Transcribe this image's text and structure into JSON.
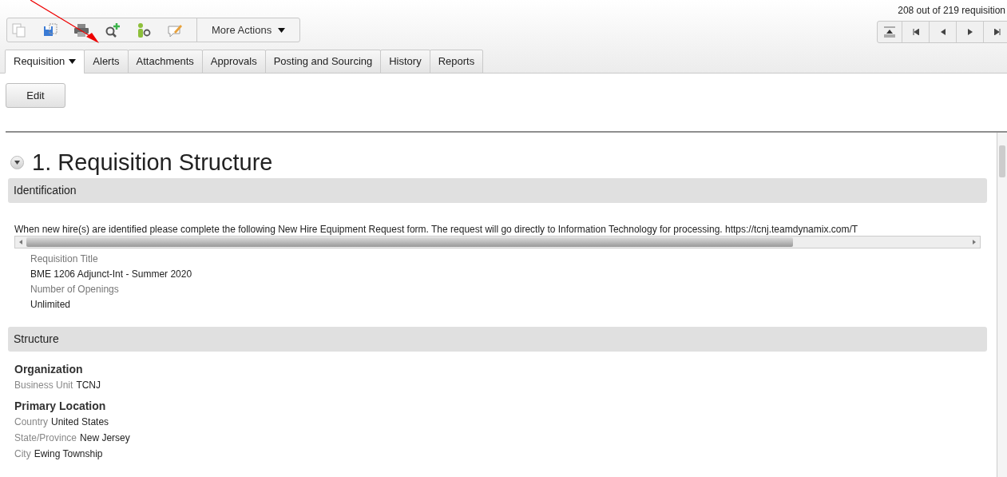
{
  "toolbar": {
    "more_actions": "More Actions"
  },
  "counter": "208 out of 219 requisition",
  "tabs": [
    {
      "label": "Requisition",
      "selected": true,
      "dropdown": true
    },
    {
      "label": "Alerts",
      "selected": false
    },
    {
      "label": "Attachments",
      "selected": false
    },
    {
      "label": "Approvals",
      "selected": false
    },
    {
      "label": "Posting and Sourcing",
      "selected": false
    },
    {
      "label": "History",
      "selected": false
    },
    {
      "label": "Reports",
      "selected": false
    }
  ],
  "edit_button": "Edit",
  "section": {
    "title": "1. Requisition Structure",
    "expanded": true
  },
  "identification": {
    "header": "Identification",
    "description": "When new hire(s) are identified please complete the following New Hire Equipment Request form. The request will go directly to Information Technology for processing. https://tcnj.teamdynamix.com/T",
    "fields": [
      {
        "label": "Requisition Title",
        "value": "BME 1206 Adjunct-Int - Summer 2020"
      },
      {
        "label": "Number of Openings",
        "value": "Unlimited"
      }
    ]
  },
  "structure": {
    "header": "Structure",
    "groups": [
      {
        "title": "Organization",
        "fields": [
          {
            "label": "Business Unit",
            "value": "TCNJ"
          }
        ]
      },
      {
        "title": "Primary Location",
        "fields": [
          {
            "label": "Country",
            "value": "United States"
          },
          {
            "label": "State/Province",
            "value": "New Jersey"
          },
          {
            "label": "City",
            "value": "Ewing Township"
          }
        ]
      }
    ]
  }
}
